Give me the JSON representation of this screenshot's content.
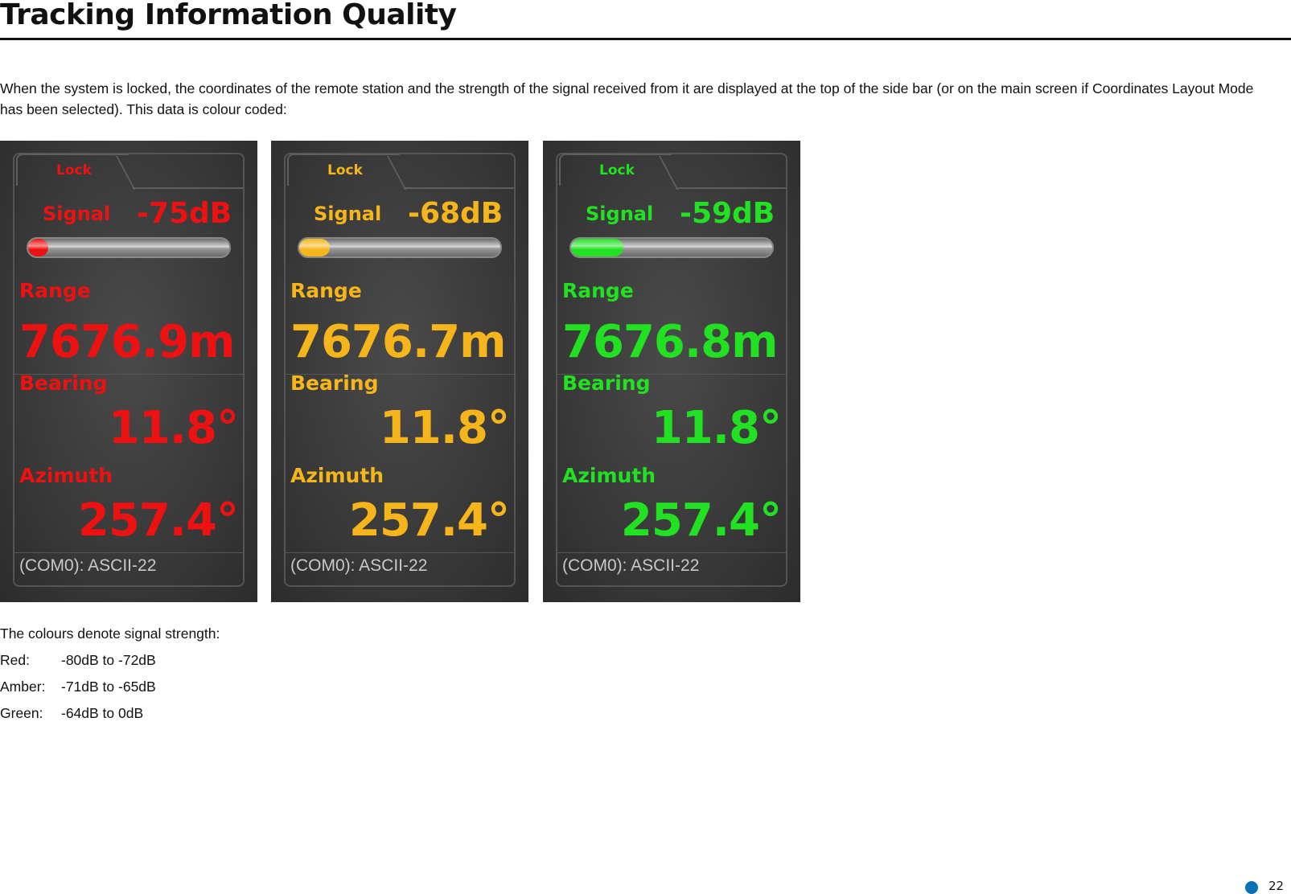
{
  "page": {
    "title": "Tracking Information Quality",
    "intro": "When the system is locked, the coordinates of the remote station and the strength of the signal received from it are displayed at the top of the side bar (or on the main screen if Coordinates Layout Mode has been selected). This data is colour coded:",
    "page_number": "22"
  },
  "panels": [
    {
      "lock": "Lock",
      "signal_label": "Signal",
      "signal_value": "-75dB",
      "signal_fill_fraction": 0.1,
      "range_label": "Range",
      "range_value": "7676.9m",
      "bearing_label": "Bearing",
      "bearing_value": "11.8°",
      "azimuth_label": "Azimuth",
      "azimuth_value": "257.4°",
      "com": "(COM0): ASCII-22",
      "color": "#ee1111"
    },
    {
      "lock": "Lock",
      "signal_label": "Signal",
      "signal_value": "-68dB",
      "signal_fill_fraction": 0.15,
      "range_label": "Range",
      "range_value": "7676.7m",
      "bearing_label": "Bearing",
      "bearing_value": "11.8°",
      "azimuth_label": "Azimuth",
      "azimuth_value": "257.4°",
      "com": "(COM0): ASCII-22",
      "color": "#f5b51b"
    },
    {
      "lock": "Lock",
      "signal_label": "Signal",
      "signal_value": "-59dB",
      "signal_fill_fraction": 0.26,
      "range_label": "Range",
      "range_value": "7676.8m",
      "bearing_label": "Bearing",
      "bearing_value": "11.8°",
      "azimuth_label": "Azimuth",
      "azimuth_value": "257.4°",
      "com": "(COM0): ASCII-22",
      "color": "#22e022"
    }
  ],
  "legend": {
    "caption": "The colours denote signal strength:",
    "rows": [
      {
        "name": "Red:",
        "range": "-80dB to -72dB",
        "color": "#ee1111"
      },
      {
        "name": "Amber:",
        "range": "-71dB to -65dB",
        "color": "#f5b51b"
      },
      {
        "name": "Green:",
        "range": "-64dB to 0dB",
        "color": "#22e022"
      }
    ]
  }
}
